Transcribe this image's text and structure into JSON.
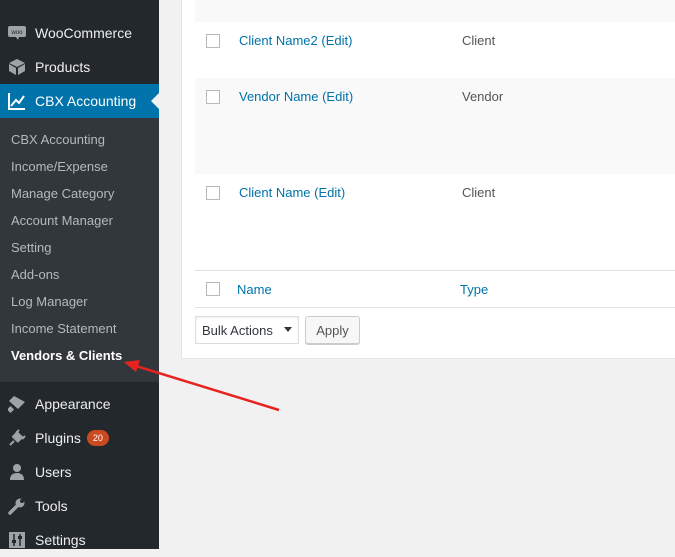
{
  "sidebar": {
    "menu": {
      "woocommerce": "WooCommerce",
      "products": "Products",
      "cbx_accounting": "CBX Accounting",
      "appearance": "Appearance",
      "plugins": "Plugins",
      "plugins_badge": "20",
      "users": "Users",
      "tools": "Tools",
      "settings": "Settings"
    },
    "woo_icon_text": "woo",
    "submenu": [
      "CBX Accounting",
      "Income/Expense",
      "Manage Category",
      "Account Manager",
      "Setting",
      "Add-ons",
      "Log Manager",
      "Income Statement",
      "Vendors & Clients"
    ]
  },
  "table": {
    "rows": [
      {
        "name": "Client Name2 (Edit)",
        "type": "Client"
      },
      {
        "name": "Vendor Name (Edit)",
        "type": "Vendor"
      },
      {
        "name": "Client Name (Edit)",
        "type": "Client"
      }
    ],
    "columns": {
      "name": "Name",
      "type": "Type"
    }
  },
  "actions": {
    "bulk_actions": "Bulk Actions",
    "apply": "Apply"
  },
  "colors": {
    "sidebar_bg": "#23282d",
    "submenu_bg": "#32373c",
    "accent": "#0073aa",
    "arrow": "#e8231f",
    "badge": "#ca4a1f"
  }
}
